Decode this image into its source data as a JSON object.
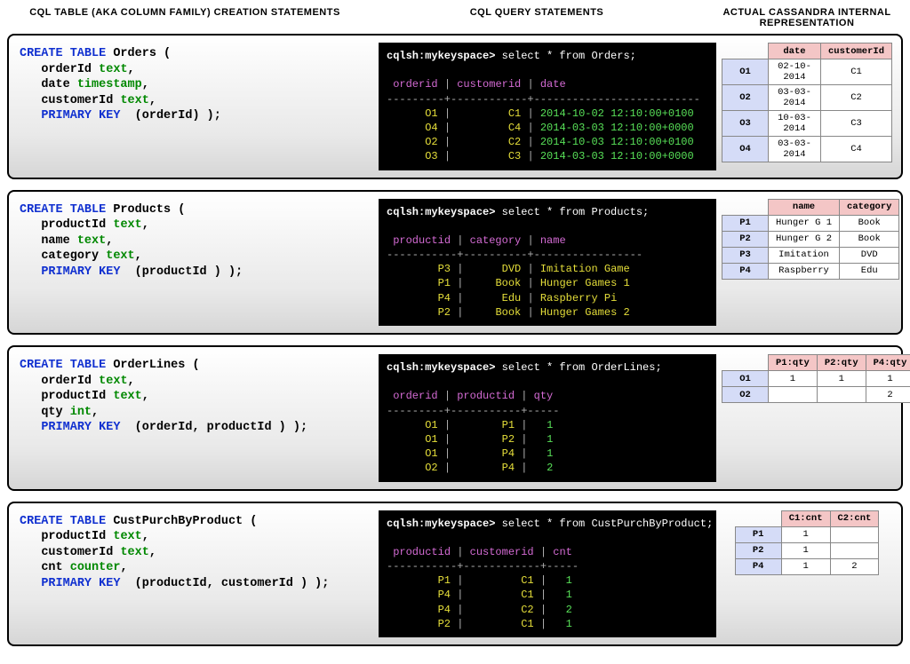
{
  "headers": {
    "create": "CQL TABLE (AKA COLUMN FAMILY) CREATION STATEMENTS",
    "query": "CQL QUERY STATEMENTS",
    "rep": "ACTUAL CASSANDRA INTERNAL REPRESENTATION"
  },
  "block1": {
    "tableName": "Orders",
    "col1": "orderId",
    "type1": "text",
    "col2": "date",
    "type2": "timestamp",
    "col3": "customerId",
    "type3": "text",
    "pk": "(orderId)",
    "prompt": "cqlsh:mykeyspace>",
    "query": "select * from Orders;",
    "cols": {
      "a": "orderid",
      "b": "customerid",
      "c": "date"
    },
    "dash": "---------+------------+--------------------------",
    "rows": [
      {
        "a": "O1",
        "b": "C1",
        "c": "2014-10-02 12:10:00+0100"
      },
      {
        "a": "O4",
        "b": "C4",
        "c": "2014-03-03 12:10:00+0000"
      },
      {
        "a": "O2",
        "b": "C2",
        "c": "2014-10-03 12:10:00+0100"
      },
      {
        "a": "O3",
        "b": "C3",
        "c": "2014-03-03 12:10:00+0000"
      }
    ],
    "rep": {
      "h1": "date",
      "h2": "customerId",
      "r": [
        {
          "k": "O1",
          "a": "02-10-2014",
          "b": "C1"
        },
        {
          "k": "O2",
          "a": "03-03-2014",
          "b": "C2"
        },
        {
          "k": "O3",
          "a": "10-03-2014",
          "b": "C3"
        },
        {
          "k": "O4",
          "a": "03-03-2014",
          "b": "C4"
        }
      ]
    }
  },
  "block2": {
    "tableName": "Products",
    "col1": "productId",
    "type1": "text",
    "col2": "name",
    "type2": "text",
    "col3": "category",
    "type3": "text",
    "pk": "(productId )",
    "prompt": "cqlsh:mykeyspace>",
    "query": "select * from Products;",
    "cols": {
      "a": "productid",
      "b": "category",
      "c": "name"
    },
    "dash": "-----------+----------+-----------------",
    "rows": [
      {
        "a": "P3",
        "b": "DVD",
        "c": "Imitation Game"
      },
      {
        "a": "P1",
        "b": "Book",
        "c": "Hunger Games 1"
      },
      {
        "a": "P4",
        "b": "Edu",
        "c": "Raspberry Pi"
      },
      {
        "a": "P2",
        "b": "Book",
        "c": "Hunger Games 2"
      }
    ],
    "rep": {
      "h1": "name",
      "h2": "category",
      "r": [
        {
          "k": "P1",
          "a": "Hunger G 1",
          "b": "Book"
        },
        {
          "k": "P2",
          "a": "Hunger G 2",
          "b": "Book"
        },
        {
          "k": "P3",
          "a": "Imitation",
          "b": "DVD"
        },
        {
          "k": "P4",
          "a": "Raspberry",
          "b": "Edu"
        }
      ]
    }
  },
  "block3": {
    "tableName": "OrderLines",
    "col1": "orderId",
    "type1": "text",
    "col2": "productId",
    "type2": "text",
    "col3": "qty",
    "type3": "int",
    "pk": "(orderId, productId )",
    "prompt": "cqlsh:mykeyspace>",
    "query": "select * from OrderLines;",
    "cols": {
      "a": "orderid",
      "b": "productid",
      "c": "qty"
    },
    "dash": "---------+-----------+-----",
    "rows": [
      {
        "a": "O1",
        "b": "P1",
        "c": "1"
      },
      {
        "a": "O1",
        "b": "P2",
        "c": "1"
      },
      {
        "a": "O1",
        "b": "P4",
        "c": "1"
      },
      {
        "a": "O2",
        "b": "P4",
        "c": "2"
      }
    ],
    "rep": {
      "h1": "P1:qty",
      "h2": "P2:qty",
      "h3": "P4:qty",
      "r": [
        {
          "k": "O1",
          "a": "1",
          "b": "1",
          "c": "1"
        },
        {
          "k": "O2",
          "a": "",
          "b": "",
          "c": "2"
        }
      ]
    }
  },
  "block4": {
    "tableName": "CustPurchByProduct",
    "col1": "productId",
    "type1": "text",
    "col2": "customerId",
    "type2": "text",
    "col3": "cnt",
    "type3": "counter",
    "pk": "(productId, customerId )",
    "prompt": "cqlsh:mykeyspace>",
    "query": "select * from CustPurchByProduct;",
    "cols": {
      "a": "productid",
      "b": "customerid",
      "c": "cnt"
    },
    "dash": "-----------+------------+-----",
    "rows": [
      {
        "a": "P1",
        "b": "C1",
        "c": "1"
      },
      {
        "a": "P4",
        "b": "C1",
        "c": "1"
      },
      {
        "a": "P4",
        "b": "C2",
        "c": "2"
      },
      {
        "a": "P2",
        "b": "C1",
        "c": "1"
      }
    ],
    "rep": {
      "h1": "C1:cnt",
      "h2": "C2:cnt",
      "r": [
        {
          "k": "P1",
          "a": "1",
          "b": ""
        },
        {
          "k": "P2",
          "a": "1",
          "b": ""
        },
        {
          "k": "P4",
          "a": "1",
          "b": "2"
        }
      ]
    }
  }
}
